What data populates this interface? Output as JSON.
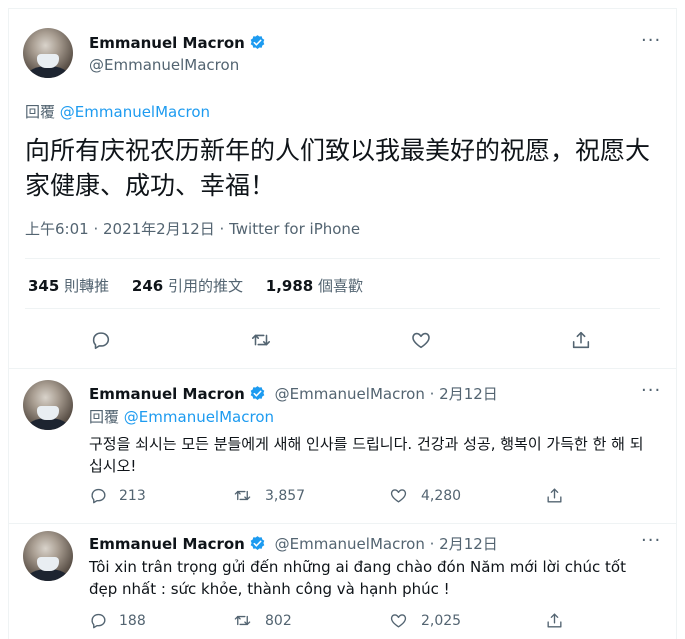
{
  "main_tweet": {
    "author_name": "Emmanuel Macron",
    "author_handle": "@EmmanuelMacron",
    "reply_label": "回覆",
    "reply_to": "@EmmanuelMacron",
    "text": "向所有庆祝农历新年的人们致以我最美好的祝愿，祝愿大家健康、成功、幸福！",
    "meta": "上午6:01 · 2021年2月12日 · Twitter for iPhone",
    "stats": {
      "retweets": "345",
      "retweets_label": "則轉推",
      "quotes": "246",
      "quotes_label": "引用的推文",
      "likes": "1,988",
      "likes_label": "個喜歡"
    }
  },
  "replies": [
    {
      "author_name": "Emmanuel Macron",
      "author_handle": "@EmmanuelMacron",
      "date": "· 2月12日",
      "reply_label": "回覆",
      "reply_to": "@EmmanuelMacron",
      "text": "구정을 쇠시는 모든 분들에게 새해 인사를 드립니다. 건강과 성공, 행복이 가득한 한 해 되십시오!",
      "replies_count": "213",
      "retweets_count": "3,857",
      "likes_count": "4,280"
    },
    {
      "author_name": "Emmanuel Macron",
      "author_handle": "@EmmanuelMacron",
      "date": "· 2月12日",
      "text": "Tôi xin trân trọng gửi đến những ai đang chào đón Năm mới lời chúc tốt đẹp nhất : sức khỏe, thành công và hạnh phúc !",
      "replies_count": "188",
      "retweets_count": "802",
      "likes_count": "2,025"
    }
  ],
  "colors": {
    "accent": "#1d9bf0",
    "muted": "#536471",
    "text": "#0f1419",
    "divider": "#eff3f4"
  },
  "icons": [
    "verified-badge-icon",
    "more-icon",
    "reply-icon",
    "retweet-icon",
    "like-icon",
    "share-icon"
  ]
}
